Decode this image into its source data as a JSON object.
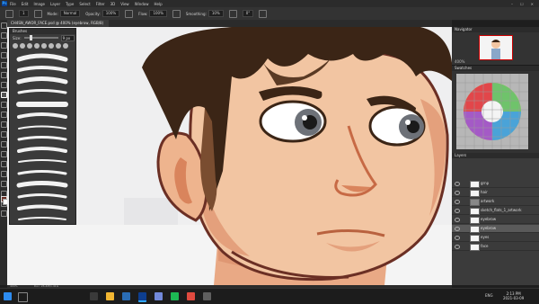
{
  "app": {
    "logo_text": "Ps",
    "menu": [
      "File",
      "Edit",
      "Image",
      "Layer",
      "Type",
      "Select",
      "Filter",
      "3D",
      "View",
      "Window",
      "Help"
    ],
    "window_controls": [
      "–",
      "☐",
      "✕"
    ]
  },
  "options": {
    "size_value": "1",
    "mode_label": "Mode:",
    "mode_value": "Normal",
    "opacity_label": "Opacity:",
    "opacity_value": "100%",
    "flow_label": "Flow:",
    "flow_value": "100%",
    "smoothing_label": "Smoothing:",
    "smoothing_value": "10%",
    "angle_value": "0°"
  },
  "document": {
    "tab_title": "CH4SN_AWOR_FACE.psd @ 400% (eyebrow, RGB/8)"
  },
  "brush_panel": {
    "title": "Brushes",
    "size_label": "Size:",
    "size_value": "9 px"
  },
  "navigator": {
    "title": "Navigator",
    "zoom": "400%"
  },
  "swatches": {
    "title": "Swatches"
  },
  "layers": {
    "title": "Layers",
    "items": [
      {
        "name": "grnp"
      },
      {
        "name": "hair"
      },
      {
        "name": "artwork"
      },
      {
        "name": "sketch_flats_1_artwork"
      },
      {
        "name": "eyebrow"
      },
      {
        "name": "eyebrow"
      },
      {
        "name": "eyes"
      },
      {
        "name": "face"
      }
    ]
  },
  "status": {
    "zoom": "400%",
    "doc_info": "Doc: 26.4M/1.41G"
  },
  "taskbar": {
    "tray_lang": "ENG",
    "time": "2:13 PM",
    "date": "2021-03-09"
  },
  "colors": {
    "hair": "#3b2516",
    "skin": "#f2c5a2",
    "skin_shadow": "#d9845c",
    "outline": "#6b2f24",
    "ps_blue": "#31a8ff"
  }
}
